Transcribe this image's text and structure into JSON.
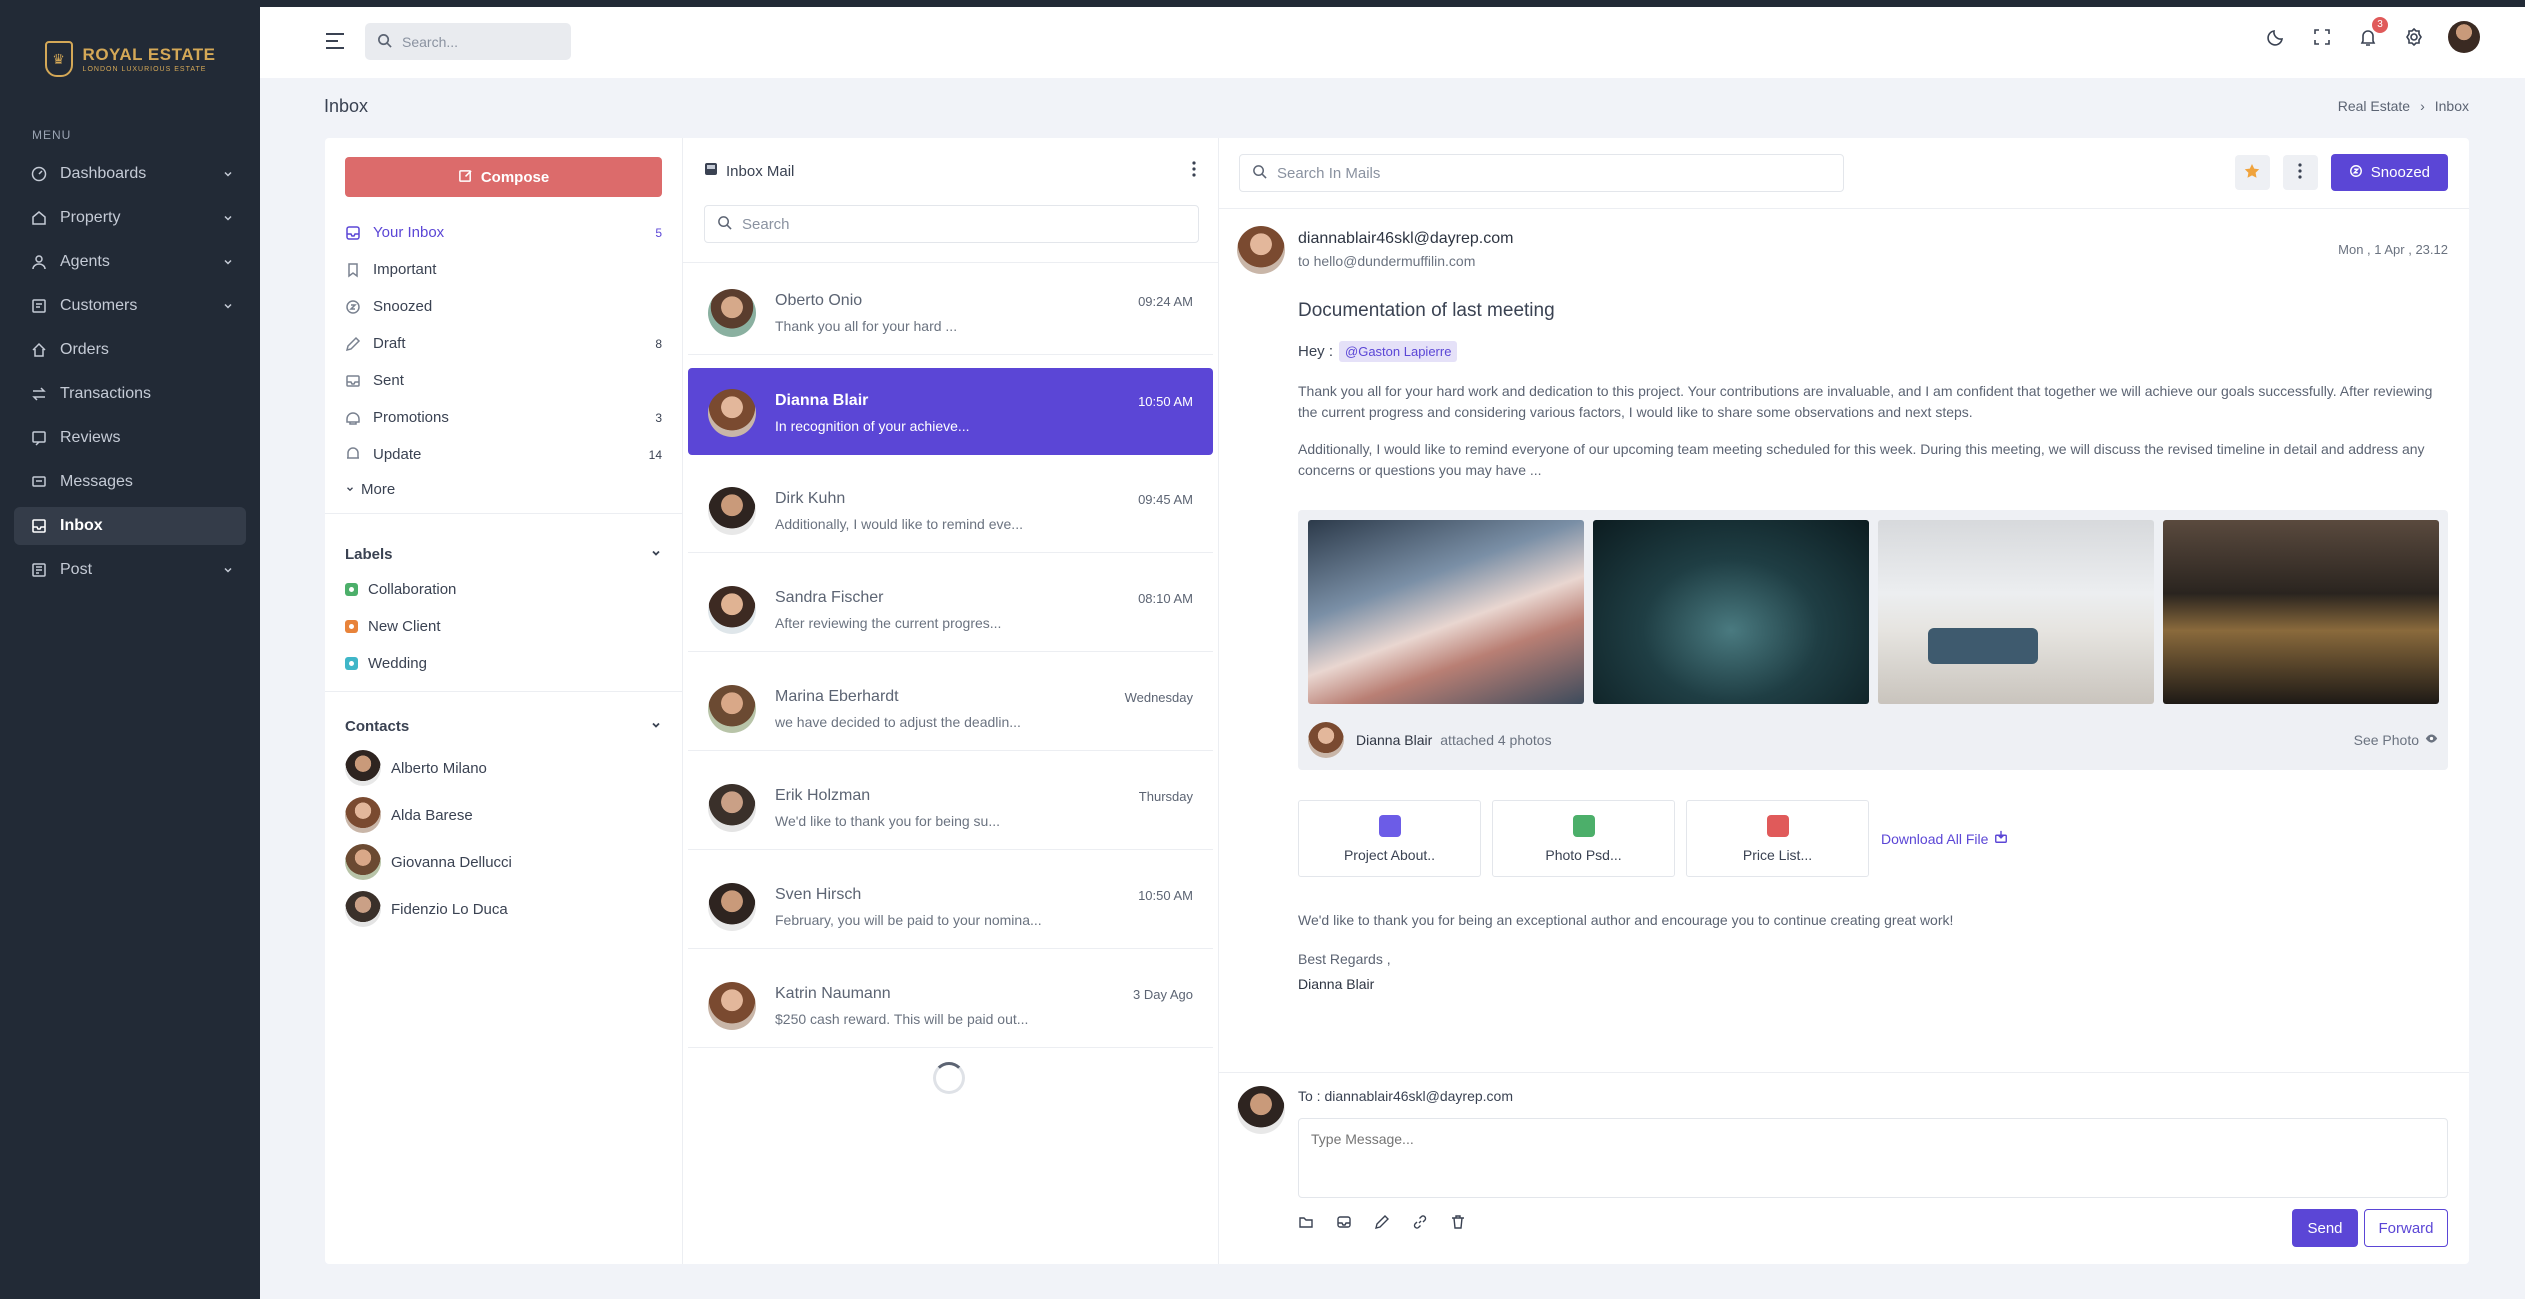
{
  "brand": {
    "name": "ROYAL ESTATE",
    "tagline": "LONDON LUXURIOUS ESTATE"
  },
  "sidebar": {
    "menu_title": "MENU",
    "items": [
      {
        "label": "Dashboards",
        "icon": "dashboard-icon",
        "has_chevron": true
      },
      {
        "label": "Property",
        "icon": "property-icon",
        "has_chevron": true
      },
      {
        "label": "Agents",
        "icon": "agents-icon",
        "has_chevron": true
      },
      {
        "label": "Customers",
        "icon": "customers-icon",
        "has_chevron": true
      },
      {
        "label": "Orders",
        "icon": "home-icon",
        "has_chevron": false
      },
      {
        "label": "Transactions",
        "icon": "transactions-icon",
        "has_chevron": false
      },
      {
        "label": "Reviews",
        "icon": "reviews-icon",
        "has_chevron": false
      },
      {
        "label": "Messages",
        "icon": "messages-icon",
        "has_chevron": false
      },
      {
        "label": "Inbox",
        "icon": "inbox-icon",
        "has_chevron": false,
        "active": true
      },
      {
        "label": "Post",
        "icon": "post-icon",
        "has_chevron": true
      }
    ]
  },
  "topbar": {
    "search_placeholder": "Search...",
    "notification_count": "3"
  },
  "page": {
    "title": "Inbox",
    "breadcrumb": [
      "Real Estate",
      "Inbox"
    ]
  },
  "folders": {
    "compose_label": "Compose",
    "items": [
      {
        "label": "Your Inbox",
        "count": "5",
        "icon": "inbox-icon",
        "active": true
      },
      {
        "label": "Important",
        "count": "",
        "icon": "bookmark-icon"
      },
      {
        "label": "Snoozed",
        "count": "",
        "icon": "snooze-icon"
      },
      {
        "label": "Draft",
        "count": "8",
        "icon": "pencil-icon"
      },
      {
        "label": "Sent",
        "count": "",
        "icon": "sent-icon"
      },
      {
        "label": "Promotions",
        "count": "3",
        "icon": "tag-icon"
      },
      {
        "label": "Update",
        "count": "14",
        "icon": "update-icon"
      }
    ],
    "more_label": "More",
    "labels_title": "Labels",
    "labels": [
      {
        "label": "Collaboration",
        "color": "#4caf6a"
      },
      {
        "label": "New Client",
        "color": "#e8833a"
      },
      {
        "label": "Wedding",
        "color": "#3fb6c8"
      }
    ],
    "contacts_title": "Contacts",
    "contacts": [
      {
        "name": "Alberto Milano"
      },
      {
        "name": "Alda Barese"
      },
      {
        "name": "Giovanna Dellucci"
      },
      {
        "name": "Fidenzio Lo Duca"
      }
    ]
  },
  "mail_list": {
    "title": "Inbox Mail",
    "search_placeholder": "Search",
    "items": [
      {
        "name": "Oberto Onio",
        "preview": "Thank you all for your hard ...",
        "time": "09:24 AM"
      },
      {
        "name": "Dianna Blair",
        "preview": "In recognition of your achieve...",
        "time": "10:50 AM",
        "active": true
      },
      {
        "name": "Dirk Kuhn",
        "preview": "Additionally, I would like to remind eve...",
        "time": "09:45 AM"
      },
      {
        "name": "Sandra Fischer",
        "preview": "After reviewing the current progres...",
        "time": "08:10 AM"
      },
      {
        "name": "Marina Eberhardt",
        "preview": "we have decided to adjust the deadlin...",
        "time": "Wednesday"
      },
      {
        "name": "Erik Holzman",
        "preview": "We'd like to thank you for being su...",
        "time": "Thursday"
      },
      {
        "name": "Sven Hirsch",
        "preview": "February, you will be paid to your nomina...",
        "time": "10:50 AM"
      },
      {
        "name": "Katrin Naumann",
        "preview": "$250 cash reward. This will be paid out...",
        "time": "3 Day Ago"
      }
    ]
  },
  "reader": {
    "search_placeholder": "Search In Mails",
    "snoozed_label": "Snoozed",
    "from": "diannablair46skl@dayrep.com",
    "to": "to hello@dundermuffilin.com",
    "date": "Mon , 1 Apr , 23.12",
    "subject": "Documentation of last meeting",
    "greeting": "Hey :",
    "mention": "@Gaston Lapierre",
    "paragraph1": "Thank you all for your hard work and dedication to this project. Your contributions are invaluable, and I am confident that together we will achieve our goals successfully. After reviewing the current progress and considering various factors, I would like to share some observations and next steps.",
    "paragraph2": "Additionally, I would like to remind everyone of our upcoming team meeting scheduled for this week. During this meeting, we will discuss the revised timeline in detail and address any concerns or questions you may have ...",
    "gallery": {
      "sender": "Dianna Blair",
      "caption": "attached 4 photos",
      "see_label": "See Photo"
    },
    "files": [
      {
        "label": "Project About..",
        "color": "#6c5ce7"
      },
      {
        "label": "Photo Psd...",
        "color": "#4caf6a"
      },
      {
        "label": "Price List...",
        "color": "#e05a5a"
      }
    ],
    "download_label": "Download All File",
    "thanks": "We'd like to thank you for being an exceptional author and encourage you to continue creating great work!",
    "regards": "Best Regards ,",
    "signature": "Dianna Blair",
    "reply": {
      "to_label": "To : diannablair46skl@dayrep.com",
      "placeholder": "Type Message...",
      "send_label": "Send",
      "forward_label": "Forward"
    }
  }
}
